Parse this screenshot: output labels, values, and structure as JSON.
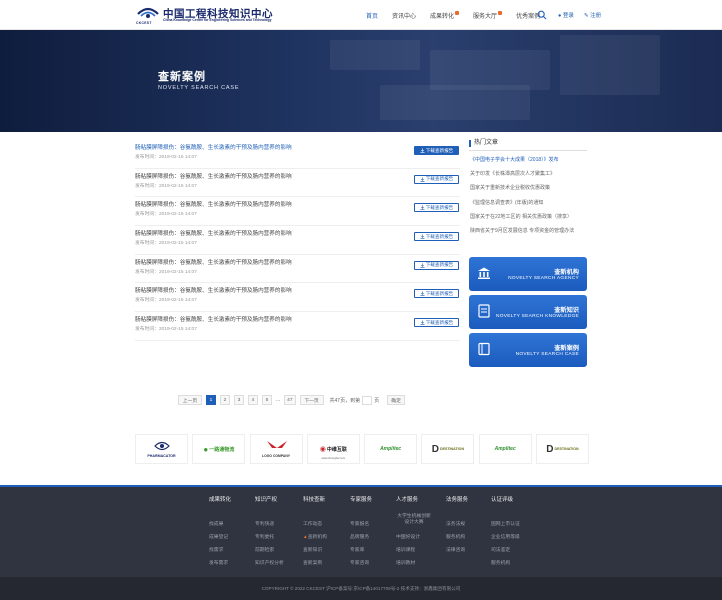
{
  "brand": {
    "abbr": "CKCEST",
    "name_cn": "中国工程科技知识中心",
    "name_en": "China Knowledge Centre for Engineering Sciences and Technology"
  },
  "nav": {
    "items": [
      {
        "label": "首页",
        "active": true,
        "dot": false
      },
      {
        "label": "资讯中心",
        "active": false,
        "dot": false
      },
      {
        "label": "成果转化",
        "active": false,
        "dot": true
      },
      {
        "label": "服务大厅",
        "active": false,
        "dot": true
      },
      {
        "label": "优秀案例",
        "active": false,
        "dot": false
      }
    ],
    "login": "登录",
    "register": "注册"
  },
  "banner": {
    "title": "查新案例",
    "subtitle": "NOVELTY SEARCH CASE"
  },
  "cases": [
    {
      "title": "肠粘膜屏障损伤：谷氨酰胺、生长激素的干预及肠内营养的影响",
      "date": "发布时间：2019-02-15 14:07",
      "button": "下载查新报告"
    },
    {
      "title": "肠粘膜屏障损伤：谷氨酰胺、生长激素的干预及肠内营养的影响",
      "date": "发布时间：2019-02-15 14:07",
      "button": "下载查新报告"
    },
    {
      "title": "肠粘膜屏障损伤：谷氨酰胺、生长激素的干预及肠内营养的影响",
      "date": "发布时间：2019-02-15 14:07",
      "button": "下载查新报告"
    },
    {
      "title": "肠粘膜屏障损伤：谷氨酰胺、生长激素的干预及肠内营养的影响",
      "date": "发布时间：2019-02-15 14:07",
      "button": "下载查新报告"
    },
    {
      "title": "肠粘膜屏障损伤：谷氨酰胺、生长激素的干预及肠内营养的影响",
      "date": "发布时间：2019-02-15 14:07",
      "button": "下载查新报告"
    },
    {
      "title": "肠粘膜屏障损伤：谷氨酰胺、生长激素的干预及肠内营养的影响",
      "date": "发布时间：2019-02-15 14:07",
      "button": "下载查新报告"
    },
    {
      "title": "肠粘膜屏障损伤：谷氨酰胺、生长激素的干预及肠内营养的影响",
      "date": "发布时间：2019-02-15 14:07",
      "button": "下载查新报告"
    }
  ],
  "sidebar": {
    "hot_title": "热门文章",
    "hot_items": [
      "《中国电子学会十大成果（2018）》发布",
      "关于印发《长株潭高层次人才聚集工》",
      "国家关于重新技术企业税收优惠政策",
      "《监理信息调查表》(年版)的通知",
      "国家关于在22地工区的 相关优惠政策（搜享）",
      "陕西省关于9月区发展信息 专项资金的管理办法"
    ],
    "buttons": [
      {
        "cn": "查新机构",
        "en": "NOVELTY SEARCH AGENCY",
        "icon": "institution-icon"
      },
      {
        "cn": "查新知识",
        "en": "NOVELTY SEARCH KNOWLEDGE",
        "icon": "document-icon"
      },
      {
        "cn": "查新案例",
        "en": "NOVELTY SEARCH CASE",
        "icon": "book-icon"
      }
    ]
  },
  "pager": {
    "prev": "上一页",
    "pages": [
      "1",
      "2",
      "3",
      "4",
      "5"
    ],
    "current": "1",
    "dots": "...",
    "last": "47",
    "next": "下一页",
    "total_prefix": "共47页，到第",
    "total_suffix": "页",
    "go": "确定"
  },
  "partners": [
    {
      "name": "PHARMACATOR",
      "sub": "",
      "color": "#1b2a6e"
    },
    {
      "name": "一路通物流",
      "sub": "",
      "color": "#3a9a2a"
    },
    {
      "name": "LOGO COMPANY",
      "sub": "",
      "color": "#c8262c"
    },
    {
      "name": "中维互联",
      "sub": "www.zhonghw.com",
      "color": "#c8262c"
    },
    {
      "name": "Amplitec",
      "sub": "",
      "color": "#2f8f2f"
    },
    {
      "name": "DESTINATION",
      "sub": "",
      "color": "#6a6a1a"
    },
    {
      "name": "Amplitec",
      "sub": "",
      "color": "#2f8f2f"
    },
    {
      "name": "DESTINATION",
      "sub": "",
      "color": "#6a6a1a"
    }
  ],
  "footer": {
    "columns": [
      {
        "title": "成果转化",
        "items": [
          "找成果",
          "成果登记",
          "找需求",
          "发布需求"
        ]
      },
      {
        "title": "知识产权",
        "items": [
          "专利快递",
          "专利委托",
          "前期检索",
          "知识产权分析"
        ]
      },
      {
        "title": "科技查新",
        "items": [
          "工作动态",
          "查新机构",
          "查新知识",
          "查新案例"
        ]
      },
      {
        "title": "专家服务",
        "items": [
          "专家报名",
          "品牌服务",
          "专家库",
          "专家咨询"
        ]
      },
      {
        "title": "人才服务",
        "items": [
          "大学生机械创新设计大赛",
          "中国好设计",
          "培训课程",
          "培训教材"
        ]
      },
      {
        "title": "法务服务",
        "items": [
          "法务法规",
          "服务机构",
          "法律咨询",
          ""
        ]
      },
      {
        "title": "认证评级",
        "items": [
          "国网上市认证",
          "企业信用等级",
          "司法鉴定",
          "服务机构"
        ]
      }
    ],
    "copyright": "COPYRIGHT © 2022 CKCEST  沪ICP备案号:京ICP备14017709号-2    技术支持：浙鑫集团有限公司"
  },
  "colors": {
    "accent": "#1f5fb8",
    "banner": "#1f3360",
    "footer": "#2f3440",
    "nav_dot": "#e86a2c"
  }
}
